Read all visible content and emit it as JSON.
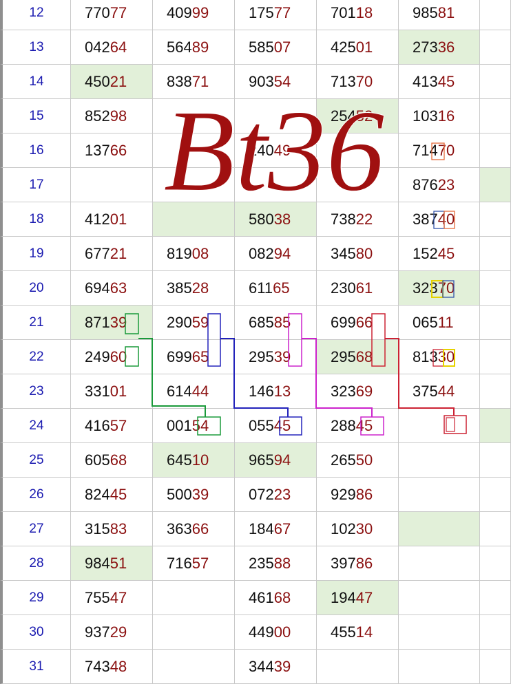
{
  "colors": {
    "day_text": "#1a1ab0",
    "num_head": "#111111",
    "num_tail": "#8b1010",
    "highlight": "#e2f0d9",
    "watermark": "#a01010"
  },
  "watermark_text": "Bt36",
  "rows": [
    {
      "day": "12",
      "cells": [
        "77077",
        "40999",
        "17577",
        "70118",
        "98581"
      ],
      "hl": []
    },
    {
      "day": "13",
      "cells": [
        "04264",
        "56489",
        "58507",
        "42501",
        "27336"
      ],
      "hl": [
        4
      ]
    },
    {
      "day": "14",
      "cells": [
        "45021",
        "83871",
        "90354",
        "71370",
        "41345"
      ],
      "hl": [
        0
      ]
    },
    {
      "day": "15",
      "cells": [
        "85298",
        "",
        "",
        "25452",
        "10316"
      ],
      "hl": [
        3
      ]
    },
    {
      "day": "16",
      "cells": [
        "13766",
        "",
        "24049",
        "",
        "71470"
      ],
      "hl": []
    },
    {
      "day": "17",
      "cells": [
        "",
        "",
        "",
        "",
        "87623"
      ],
      "hl": [
        5
      ]
    },
    {
      "day": "18",
      "cells": [
        "41201",
        "",
        "58038",
        "73822",
        "38740"
      ],
      "hl": [
        1,
        2
      ]
    },
    {
      "day": "19",
      "cells": [
        "67721",
        "81908",
        "08294",
        "34580",
        "15245"
      ],
      "hl": []
    },
    {
      "day": "20",
      "cells": [
        "69463",
        "38528",
        "61165",
        "23061",
        "32370"
      ],
      "hl": [
        4
      ]
    },
    {
      "day": "21",
      "cells": [
        "87139",
        "29059",
        "68585",
        "69966",
        "06511"
      ],
      "hl": [
        0
      ]
    },
    {
      "day": "22",
      "cells": [
        "24960",
        "69965",
        "29539",
        "29568",
        "81330"
      ],
      "hl": [
        3
      ]
    },
    {
      "day": "23",
      "cells": [
        "33101",
        "61444",
        "14613",
        "32369",
        "37544"
      ],
      "hl": []
    },
    {
      "day": "24",
      "cells": [
        "41657",
        "00154",
        "05545",
        "28845",
        ""
      ],
      "hl": [
        5
      ]
    },
    {
      "day": "25",
      "cells": [
        "60568",
        "64510",
        "96594",
        "26550",
        ""
      ],
      "hl": [
        1,
        2
      ]
    },
    {
      "day": "26",
      "cells": [
        "82445",
        "50039",
        "07223",
        "92986",
        ""
      ],
      "hl": []
    },
    {
      "day": "27",
      "cells": [
        "31583",
        "36366",
        "18467",
        "10230",
        ""
      ],
      "hl": [
        4
      ]
    },
    {
      "day": "28",
      "cells": [
        "98451",
        "71657",
        "23588",
        "39786",
        ""
      ],
      "hl": [
        0
      ]
    },
    {
      "day": "29",
      "cells": [
        "75547",
        "",
        "46168",
        "19447",
        ""
      ],
      "hl": [
        3
      ]
    },
    {
      "day": "30",
      "cells": [
        "93729",
        "",
        "44900",
        "45514",
        ""
      ],
      "hl": []
    },
    {
      "day": "31",
      "cells": [
        "74348",
        "",
        "34439",
        "",
        ""
      ],
      "hl": []
    }
  ]
}
